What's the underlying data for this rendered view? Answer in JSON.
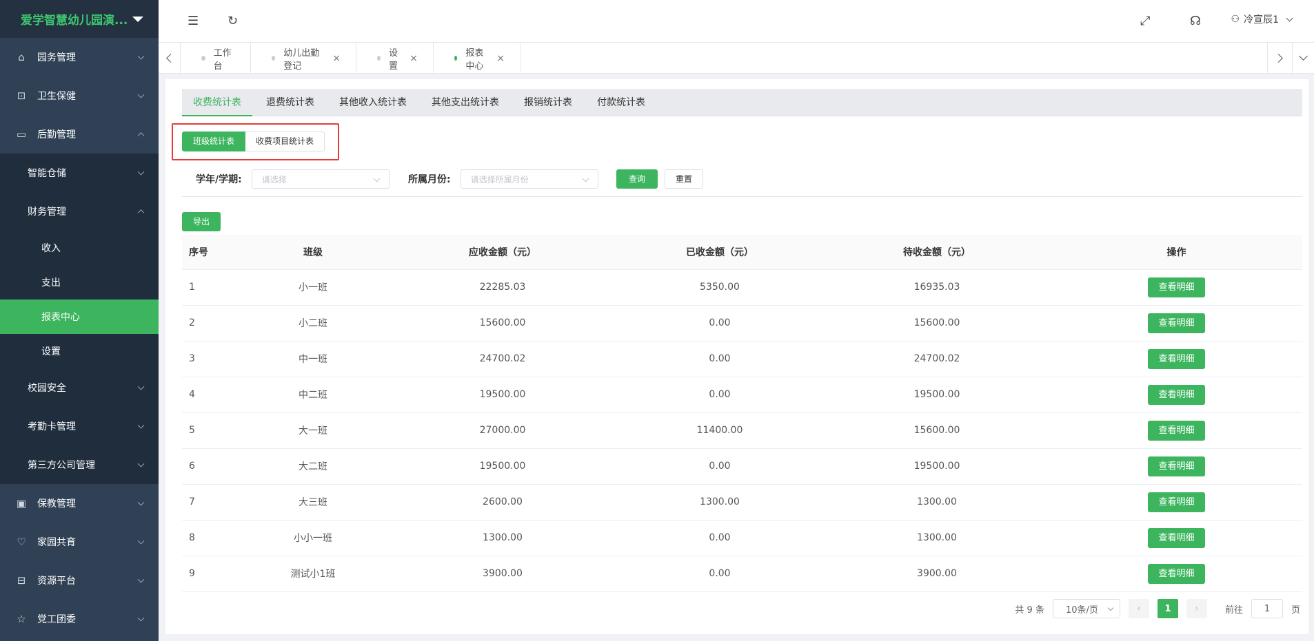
{
  "app": {
    "title": "爱学智慧幼儿园演..."
  },
  "sidebar": {
    "items": [
      {
        "label": "园务管理",
        "icon": "building-icon"
      },
      {
        "label": "卫生保健",
        "icon": "health-icon"
      },
      {
        "label": "后勤管理",
        "icon": "logistics-icon"
      },
      {
        "label": "保教管理",
        "icon": "briefcase-icon"
      },
      {
        "label": "家园共育",
        "icon": "heart-icon"
      },
      {
        "label": "资源平台",
        "icon": "inbox-icon"
      },
      {
        "label": "党工团委",
        "icon": "star-icon"
      }
    ],
    "logistics_sub": {
      "warehouse": "智能仓储",
      "finance": "财务管理",
      "finance_leaves": [
        "收入",
        "支出",
        "报表中心",
        "设置"
      ],
      "safety": "校园安全",
      "attendance_card": "考勤卡管理",
      "third_party": "第三方公司管理"
    }
  },
  "header": {
    "user": "冷宣辰1"
  },
  "tabs": [
    {
      "label": "工作台",
      "closable": false
    },
    {
      "label": "幼儿出勤登记",
      "closable": true
    },
    {
      "label": "设置",
      "closable": true
    },
    {
      "label": "报表中心",
      "closable": true
    }
  ],
  "tab_close": "×",
  "report_tabs": [
    "收费统计表",
    "退费统计表",
    "其他收入统计表",
    "其他支出统计表",
    "报销统计表",
    "付款统计表"
  ],
  "segment": {
    "on": "班级统计表",
    "off": "收费项目统计表"
  },
  "filters": {
    "term_label": "学年/学期:",
    "term_placeholder": "请选择",
    "month_label": "所属月份:",
    "month_placeholder": "请选择所属月份",
    "query": "查询",
    "reset": "重置"
  },
  "export_label": "导出",
  "table": {
    "headers": [
      "序号",
      "班级",
      "应收金额（元）",
      "已收金额（元）",
      "待收金额（元）",
      "操作"
    ],
    "action_label": "查看明细",
    "rows": [
      [
        "1",
        "小一班",
        "22285.03",
        "5350.00",
        "16935.03"
      ],
      [
        "2",
        "小二班",
        "15600.00",
        "0.00",
        "15600.00"
      ],
      [
        "3",
        "中一班",
        "24700.02",
        "0.00",
        "24700.02"
      ],
      [
        "4",
        "中二班",
        "19500.00",
        "0.00",
        "19500.00"
      ],
      [
        "5",
        "大一班",
        "27000.00",
        "11400.00",
        "15600.00"
      ],
      [
        "6",
        "大二班",
        "19500.00",
        "0.00",
        "19500.00"
      ],
      [
        "7",
        "大三班",
        "2600.00",
        "1300.00",
        "1300.00"
      ],
      [
        "8",
        "小小一班",
        "1300.00",
        "0.00",
        "1300.00"
      ],
      [
        "9",
        "测试小1班",
        "3900.00",
        "0.00",
        "3900.00"
      ]
    ]
  },
  "pagination": {
    "total": "共 9 条",
    "page_size": "10条/页",
    "prev": "‹",
    "current": "1",
    "next": "›",
    "goto_label": "前往",
    "goto_value": "1",
    "page_suffix": "页"
  },
  "colors": {
    "accent": "#3cb55e",
    "sidebar": "#304156",
    "highlight": "#e53935"
  }
}
